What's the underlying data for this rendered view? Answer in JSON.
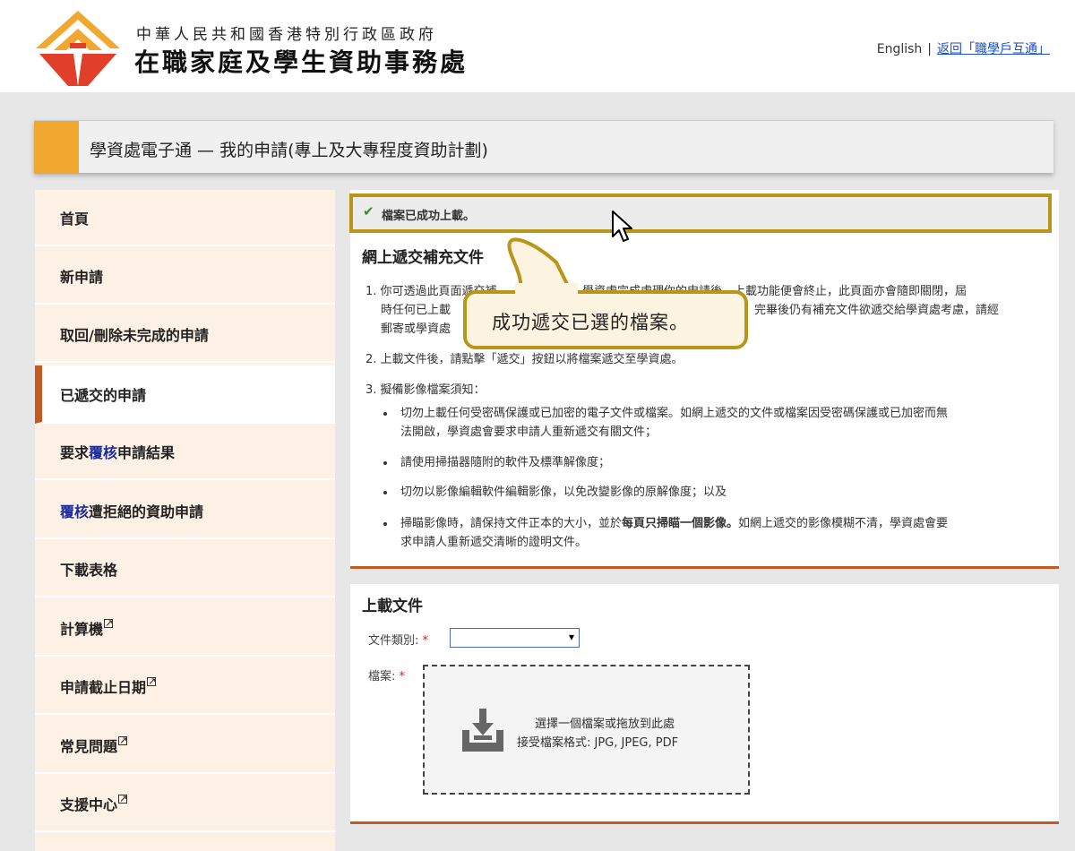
{
  "header": {
    "org_sub": "中華人民共和國香港特別行政區政府",
    "org_main": "在職家庭及學生資助事務處",
    "lang_link": "English",
    "separator": "|",
    "back_link": "返回「職學戶互通」"
  },
  "page_title": "學資處電子通 — 我的申請(專上及大專程度資助計劃)",
  "sidebar": {
    "items": [
      {
        "label": "首頁"
      },
      {
        "label": "新申請"
      },
      {
        "label": "取回/刪除未完成的申請"
      },
      {
        "label": "已遞交的申請",
        "active": true
      },
      {
        "pre": "要求",
        "hl": "覆核",
        "post": "申請結果"
      },
      {
        "hl": "覆核",
        "post": "遭拒絕的資助申請"
      },
      {
        "label": "下載表格"
      },
      {
        "label": "計算機",
        "external": true
      },
      {
        "label": "申請截止日期",
        "external": true
      },
      {
        "label": "常見問題",
        "external": true
      },
      {
        "label": "支援中心",
        "external": true
      }
    ]
  },
  "alert": {
    "icon": "check-icon",
    "message": "檔案已成功上載。"
  },
  "supplement": {
    "title": "網上遞交補充文件",
    "p1_l1": "1. 你可透過此頁面遞交補",
    "p1_l1b": "學資處完成處理你的申請後，上載功能便會終止，此頁面亦會隨即關閉，屆",
    "p1_l2": "時任何已上載",
    "p1_l2b": "完畢後仍有補充文件欲遞交給學資處考慮，請經",
    "p1_l3": "郵寄或學資處",
    "p2": "2. 上載文件後，請點擊「遞交」按鈕以將檔案遞交至學資處。",
    "p3": "3. 擬備影像檔案須知：",
    "b1_l1": "切勿上載任何受密碼保護或已加密的電子文件或檔案。如網上遞交的文件或檔案因受密碼保護或已加密而無",
    "b1_l2": "法開啟，學資處會要求申請人重新遞交有關文件；",
    "b2": "請使用掃描器隨附的軟件及標準解像度；",
    "b3": "切勿以影像編輯軟件編輯影像，以免改變影像的原解像度；以及",
    "b4_pre": "掃瞄影像時，請保持文件正本的大小，並於",
    "b4_bold": "每頁只掃瞄一個影像。",
    "b4_post": "如網上遞交的影像模糊不清，學資處會要",
    "b4_l2": "求申請人重新遞交清晰的證明文件。"
  },
  "upload": {
    "title": "上載文件",
    "doc_type_label": "文件類別:",
    "file_label": "檔案:",
    "required_mark": "*",
    "selected_value": "",
    "drop_text": "選擇一個檔案或拖放到此處",
    "formats_text": "接受檔案格式: JPG, JPEG, PDF"
  },
  "callout": {
    "text": "成功遞交已選的檔案。"
  },
  "colors": {
    "accent_orange": "#f0a830",
    "nav_active_border": "#c45a22",
    "highlight_gold": "#b8961a",
    "link_blue": "#1a4fd0"
  }
}
